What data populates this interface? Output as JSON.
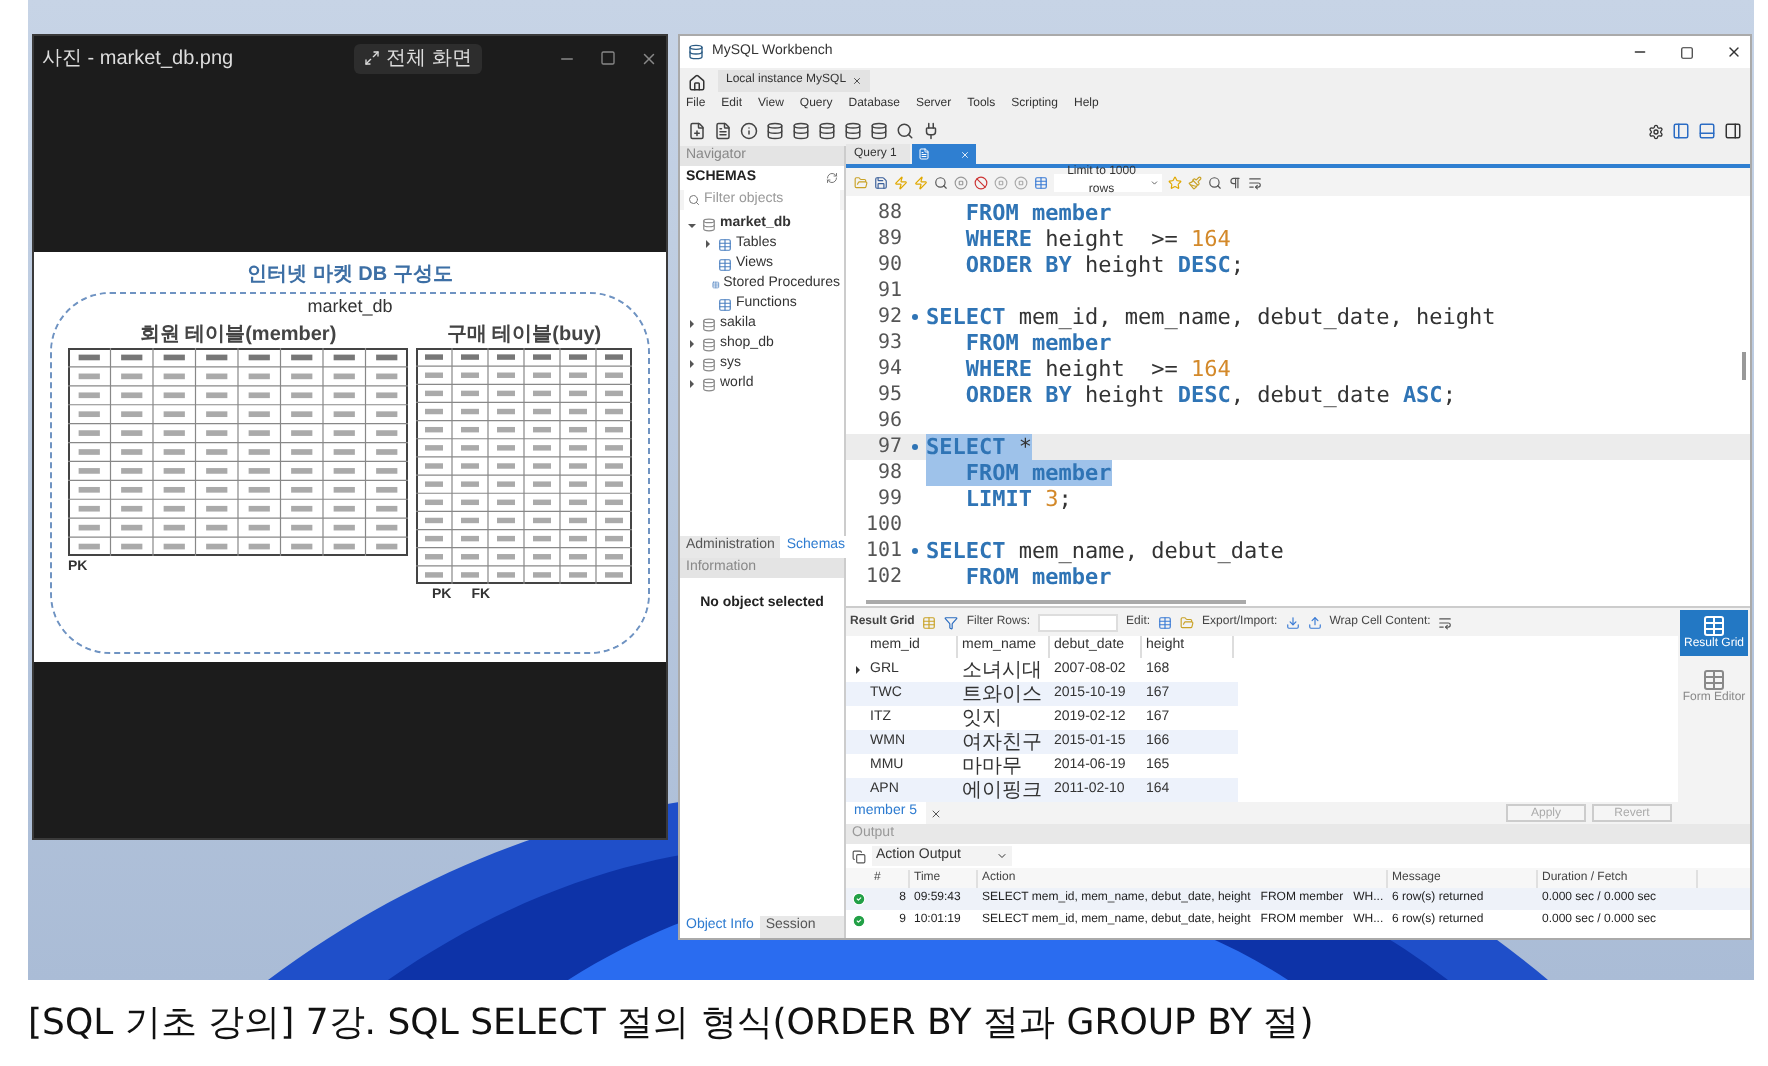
{
  "viewer": {
    "title": "사진 - market_db.png",
    "fullscreen_button": "전체 화면"
  },
  "diagram": {
    "title": "인터넷 마켓 DB 구성도",
    "database": "market_db",
    "left_table_title": "회원 테이블(member)",
    "right_table_title": "구매 테이블(buy)",
    "left_keys": [
      "PK"
    ],
    "right_keys": [
      "PK",
      "FK"
    ]
  },
  "workbench": {
    "title": "MySQL Workbench",
    "connection_tab": "Local instance MySQL",
    "menu": [
      "File",
      "Edit",
      "View",
      "Query",
      "Database",
      "Server",
      "Tools",
      "Scripting",
      "Help"
    ],
    "navigator": {
      "header": "Navigator",
      "schemas_label": "SCHEMAS",
      "filter_placeholder": "Filter objects",
      "tree": [
        {
          "label": "market_db",
          "kind": "schema",
          "default": true,
          "expanded": true,
          "children": [
            {
              "label": "Tables",
              "kind": "folder",
              "expanded": false
            },
            {
              "label": "Views",
              "kind": "folder"
            },
            {
              "label": "Stored Procedures",
              "kind": "folder"
            },
            {
              "label": "Functions",
              "kind": "folder"
            }
          ]
        },
        {
          "label": "sakila",
          "kind": "schema",
          "default": false,
          "expanded": false
        },
        {
          "label": "shop_db",
          "kind": "schema",
          "default": false,
          "expanded": false
        },
        {
          "label": "sys",
          "kind": "schema",
          "default": false,
          "expanded": false
        },
        {
          "label": "world",
          "kind": "schema",
          "default": false,
          "expanded": false
        }
      ],
      "tabs": [
        {
          "label": "Administration",
          "selected": false
        },
        {
          "label": "Schemas",
          "selected": true
        }
      ],
      "info_header": "Information",
      "info_text": "No object selected",
      "bottom_tabs": [
        {
          "label": "Object Info",
          "selected": true
        },
        {
          "label": "Session",
          "selected": false
        }
      ]
    },
    "editor_tabs": [
      {
        "label": "Query 1",
        "selected": false
      }
    ],
    "active_tab_selected": true,
    "limit": "Limit to 1000 rows",
    "code": [
      {
        "num": "88",
        "statement": false,
        "selected": false,
        "current": false,
        "tokens": [
          {
            "text": "   FROM",
            "kind": "keyword"
          },
          {
            "text": " member",
            "kind": "keyword"
          }
        ]
      },
      {
        "num": "89",
        "statement": false,
        "selected": false,
        "current": false,
        "tokens": [
          {
            "text": "   WHERE",
            "kind": "keyword"
          },
          {
            "text": " height  >= ",
            "kind": "plain"
          },
          {
            "text": "164",
            "kind": "number"
          }
        ]
      },
      {
        "num": "90",
        "statement": false,
        "selected": false,
        "current": false,
        "tokens": [
          {
            "text": "   ORDER BY",
            "kind": "keyword"
          },
          {
            "text": " height ",
            "kind": "plain"
          },
          {
            "text": "DESC",
            "kind": "keyword"
          },
          {
            "text": ";",
            "kind": "plain"
          }
        ]
      },
      {
        "num": "91",
        "statement": false,
        "selected": false,
        "current": false
      },
      {
        "num": "92",
        "statement": true,
        "selected": false,
        "current": false,
        "tokens": [
          {
            "text": "SELECT",
            "kind": "keyword"
          },
          {
            "text": " mem_id, mem_name, debut_date, height",
            "kind": "plain"
          }
        ]
      },
      {
        "num": "93",
        "statement": false,
        "selected": false,
        "current": false,
        "tokens": [
          {
            "text": "   FROM",
            "kind": "keyword"
          },
          {
            "text": " member",
            "kind": "keyword"
          }
        ]
      },
      {
        "num": "94",
        "statement": false,
        "selected": false,
        "current": false,
        "tokens": [
          {
            "text": "   WHERE",
            "kind": "keyword"
          },
          {
            "text": " height  >= ",
            "kind": "plain"
          },
          {
            "text": "164",
            "kind": "number"
          }
        ]
      },
      {
        "num": "95",
        "statement": false,
        "selected": false,
        "current": false,
        "tokens": [
          {
            "text": "   ORDER BY",
            "kind": "keyword"
          },
          {
            "text": " height ",
            "kind": "plain"
          },
          {
            "text": "DESC",
            "kind": "keyword"
          },
          {
            "text": ", debut_date ",
            "kind": "plain"
          },
          {
            "text": "ASC",
            "kind": "keyword"
          },
          {
            "text": ";",
            "kind": "plain"
          }
        ]
      },
      {
        "num": "96",
        "statement": false,
        "selected": false,
        "current": false
      },
      {
        "num": "97",
        "statement": true,
        "selected": true,
        "current": true,
        "tokens": [
          {
            "text": "SELECT",
            "kind": "keyword"
          },
          {
            "text": " *",
            "kind": "plain"
          }
        ]
      },
      {
        "num": "98",
        "statement": false,
        "selected": true,
        "current": false,
        "tokens": [
          {
            "text": "   FROM",
            "kind": "keyword"
          },
          {
            "text": " member",
            "kind": "keyword"
          }
        ]
      },
      {
        "num": "99",
        "statement": false,
        "selected": false,
        "current": false,
        "tokens": [
          {
            "text": "   LIMIT",
            "kind": "keyword"
          },
          {
            "text": " 3",
            "kind": "number"
          },
          {
            "text": ";",
            "kind": "plain"
          }
        ]
      },
      {
        "num": "100",
        "statement": false,
        "selected": false,
        "current": false
      },
      {
        "num": "101",
        "statement": true,
        "selected": false,
        "current": false,
        "tokens": [
          {
            "text": "SELECT",
            "kind": "keyword"
          },
          {
            "text": " mem_name, debut_date",
            "kind": "plain"
          }
        ]
      },
      {
        "num": "102",
        "statement": false,
        "selected": false,
        "current": false,
        "tokens": [
          {
            "text": "   FROM",
            "kind": "keyword"
          },
          {
            "text": " member",
            "kind": "keyword"
          }
        ]
      }
    ],
    "result_toolbar": {
      "result_grid": "Result Grid",
      "filter": "Filter Rows:",
      "edit": "Edit:",
      "export": "Export/Import:",
      "wrap": "Wrap Cell Content:"
    },
    "result_columns": [
      "mem_id",
      "mem_name",
      "debut_date",
      "height"
    ],
    "result_rows": [
      {
        "current": true,
        "cells": [
          "GRL",
          "소녀시대",
          "2007-08-02",
          "168"
        ]
      },
      {
        "current": false,
        "cells": [
          "TWC",
          "트와이스",
          "2015-10-19",
          "167"
        ]
      },
      {
        "current": false,
        "cells": [
          "ITZ",
          "잇지",
          "2019-02-12",
          "167"
        ]
      },
      {
        "current": false,
        "cells": [
          "WMN",
          "여자친구",
          "2015-01-15",
          "166"
        ]
      },
      {
        "current": false,
        "cells": [
          "MMU",
          "마마무",
          "2014-06-19",
          "165"
        ]
      },
      {
        "current": false,
        "cells": [
          "APN",
          "에이핑크",
          "2011-02-10",
          "164"
        ]
      }
    ],
    "result_side": [
      {
        "label": "Result Grid",
        "selected": true
      },
      {
        "label": "Form Editor",
        "selected": false
      }
    ],
    "result_tab": "member 5",
    "result_buttons": [
      {
        "label": "Apply",
        "disabled": true
      },
      {
        "label": "Revert",
        "disabled": true
      }
    ],
    "output": {
      "header": "Output",
      "selector": "Action Output",
      "columns": [
        "#",
        "Time",
        "Action",
        "Message",
        "Duration / Fetch"
      ],
      "rows": [
        {
          "success": true,
          "num": "8",
          "time": "09:59:43",
          "action": "SELECT mem_id, mem_name, debut_date, height   FROM member   WH...",
          "message": "6 row(s) returned",
          "duration": "0.000 sec / 0.000 sec"
        },
        {
          "success": true,
          "num": "9",
          "time": "10:01:19",
          "action": "SELECT mem_id, mem_name, debut_date, height   FROM member   WH...",
          "message": "6 row(s) returned",
          "duration": "0.000 sec / 0.000 sec"
        }
      ]
    }
  },
  "caption": "[SQL 기초 강의] 7강. SQL SELECT 절의 형식(ORDER BY 절과 GROUP BY 절)"
}
